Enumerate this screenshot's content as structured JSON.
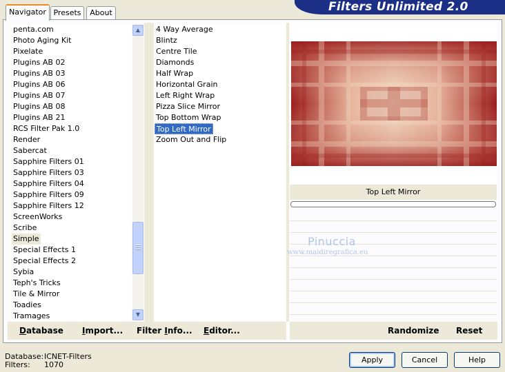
{
  "title": "Filters Unlimited 2.0",
  "tabs": [
    {
      "label": "Navigator"
    },
    {
      "label": "Presets"
    },
    {
      "label": "About"
    }
  ],
  "categories": [
    "penta.com",
    "Photo Aging Kit",
    "Pixelate",
    "Plugins AB 02",
    "Plugins AB 03",
    "Plugins AB 06",
    "Plugins AB 07",
    "Plugins AB 08",
    "Plugins AB 21",
    "RCS Filter Pak 1.0",
    "Render",
    "Sabercat",
    "Sapphire Filters 01",
    "Sapphire Filters 03",
    "Sapphire Filters 04",
    "Sapphire Filters 09",
    "Sapphire Filters 12",
    "ScreenWorks",
    "Scribe",
    "Simple",
    "Special Effects 1",
    "Special Effects 2",
    "Sybia",
    "Teph's Tricks",
    "Tile & Mirror",
    "Toadies",
    "Tramages"
  ],
  "filters": [
    "4 Way Average",
    "Blintz",
    "Centre Tile",
    "Diamonds",
    "Half Wrap",
    "Horizontal Grain",
    "Left Right Wrap",
    "Pizza Slice Mirror",
    "Top Bottom Wrap",
    "Top Left Mirror",
    "Zoom Out and Flip"
  ],
  "selected_category": "Simple",
  "selected_filter": "Top Left Mirror",
  "preview_filter_name": "Top Left Mirror",
  "progress": 0,
  "watermark": {
    "name": "Pinuccia",
    "url": "www.maidiregrafica.eu"
  },
  "bottom_links": {
    "database": {
      "underline": "D",
      "rest": "atabase"
    },
    "import": {
      "underline": "I",
      "rest": "mport..."
    },
    "filter_info": {
      "pre": "Filter ",
      "underline": "I",
      "rest": "nfo..."
    },
    "editor": {
      "underline": "E",
      "rest": "ditor..."
    },
    "randomize": "Randomize",
    "reset": "Reset"
  },
  "status": {
    "database_label": "Database:",
    "database_value": "ICNET-Filters",
    "filters_label": "Filters:",
    "filters_value": "1070"
  },
  "buttons": {
    "apply": "Apply",
    "cancel": "Cancel",
    "help": "Help"
  },
  "colors": {
    "selection": "#316ac5",
    "banner": "#1b2f86",
    "tab_accent": "#e68b2c",
    "preview_dark": "#9a1c1c",
    "preview_light": "#f2d6bf"
  }
}
